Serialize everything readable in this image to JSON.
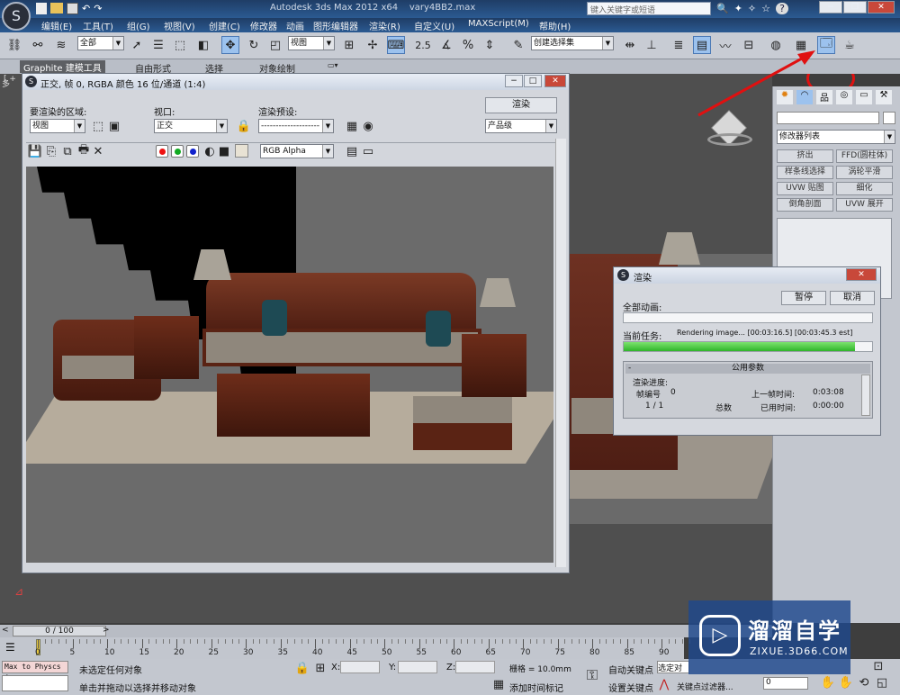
{
  "window": {
    "title": "Autodesk 3ds Max  2012 x64",
    "file": "vary4BB2.max",
    "search_placeholder": "键入关键字或短语"
  },
  "menu": [
    "编辑(E)",
    "工具(T)",
    "组(G)",
    "视图(V)",
    "创建(C)",
    "修改器",
    "动画",
    "图形编辑器",
    "渲染(R)",
    "自定义(U)",
    "MAXScript(M)",
    "帮助(H)"
  ],
  "toolbar": {
    "selection_filter": "全部",
    "ref_coord": "视图",
    "named_selection": "创建选择集",
    "spinner_label": "2.5"
  },
  "ribbon": {
    "tabs": [
      "Graphite 建模工具",
      "自由形式",
      "选择",
      "对象绘制"
    ],
    "left_label": "多"
  },
  "viewport_label": "[ +",
  "frame_window": {
    "title": "正交, 帧 0, RGBA 颜色 16 位/通道 (1:4)",
    "area_label": "要渲染的区域:",
    "area_value": "视图",
    "viewport_label": "视口:",
    "viewport_value": "正交",
    "preset_label": "渲染预设:",
    "preset_value": "--------------------",
    "render_button": "渲染",
    "quality_value": "产品级",
    "channel_value": "RGB Alpha"
  },
  "render_dialog": {
    "title": "渲染",
    "all_anim_label": "全部动画:",
    "pause_button": "暂停",
    "cancel_button": "取消",
    "current_task_label": "当前任务:",
    "task_status": "Rendering image... [00:03:16.5] [00:03:45.3 est]",
    "task_progress": 0.93,
    "all_anim_progress": 0.0,
    "params_header": "公用参数",
    "progress_label": "渲染进度:",
    "frame_label": "帧编号",
    "frame_value": "0",
    "last_frame_label": "上一帧时间:",
    "last_frame_value": "0:03:08",
    "frame_count": "1 / 1",
    "total_label": "总数",
    "elapsed_label": "已用时间:",
    "elapsed_value": "0:00:00"
  },
  "command_panel": {
    "modifier_list": "修改器列表",
    "buttons": [
      "挤出",
      "FFD(圆柱体)",
      "样条线选择",
      "涡轮平滑",
      "UVW 贴图",
      "细化",
      "倒角剖面",
      "UVW 展开"
    ]
  },
  "timeline": {
    "frame_display": "0 / 100",
    "ticks": [
      "0",
      "5",
      "10",
      "15",
      "20",
      "25",
      "30",
      "35",
      "40",
      "45",
      "50",
      "55",
      "60",
      "65",
      "70",
      "75",
      "80",
      "85",
      "90"
    ]
  },
  "status": {
    "listener_text": "Max to Physcs (",
    "selection_text": "未选定任何对象",
    "prompt_text": "单击并拖动以选择并移动对象",
    "x_label": "X:",
    "y_label": "Y:",
    "z_label": "Z:",
    "grid_text": "栅格 = 10.0mm",
    "add_time_tag": "添加时间标记",
    "auto_key": "自动关键点",
    "auto_key_value": "选定对象",
    "set_key": "设置关键点",
    "key_filter": "关键点过滤器...",
    "frame_value": "0"
  },
  "watermark": {
    "brand": "溜溜自学",
    "url": "ZIXUE.3D66.COM"
  },
  "colors": {
    "annotation_red": "#e01010",
    "progress_green": "#35bf2e",
    "title_blue": "#23497c"
  }
}
